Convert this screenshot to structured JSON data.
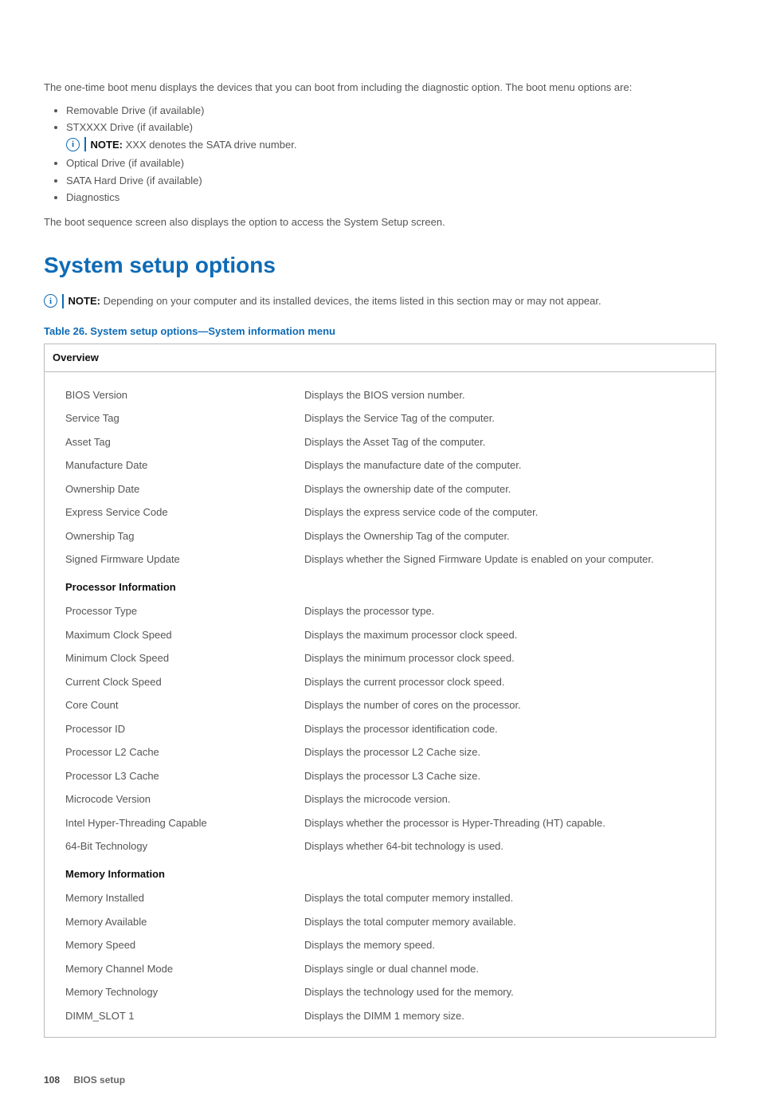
{
  "intro": "The one-time boot menu displays the devices that you can boot from including the diagnostic option. The boot menu options are:",
  "boot_list": {
    "item1": "Removable Drive (if available)",
    "item2": "STXXXX Drive (if available)",
    "item2_note_label": "NOTE:",
    "item2_note_text": " XXX denotes the SATA drive number.",
    "item3": "Optical Drive (if available)",
    "item4": "SATA Hard Drive (if available)",
    "item5": "Diagnostics"
  },
  "boot_seq": "The boot sequence screen also displays the option to access the System Setup screen.",
  "heading": "System setup options",
  "section_note_label": "NOTE:",
  "section_note_text": " Depending on your computer and its installed devices, the items listed in this section may or may not appear.",
  "table_caption": "Table 26. System setup options—System information menu",
  "table_header": "Overview",
  "rows": {
    "r0": {
      "l": "BIOS Version",
      "r": "Displays the BIOS version number."
    },
    "r1": {
      "l": "Service Tag",
      "r": "Displays the Service Tag of the computer."
    },
    "r2": {
      "l": "Asset Tag",
      "r": "Displays the Asset Tag of the computer."
    },
    "r3": {
      "l": "Manufacture Date",
      "r": "Displays the manufacture date of the computer."
    },
    "r4": {
      "l": "Ownership Date",
      "r": "Displays the ownership date of the computer."
    },
    "r5": {
      "l": "Express Service Code",
      "r": "Displays the express service code of the computer."
    },
    "r6": {
      "l": "Ownership Tag",
      "r": "Displays the Ownership Tag of the computer."
    },
    "r7": {
      "l": "Signed Firmware Update",
      "r": "Displays whether the Signed Firmware Update is enabled on your computer."
    },
    "sh1": "Processor Information",
    "r8": {
      "l": "Processor Type",
      "r": "Displays the processor type."
    },
    "r9": {
      "l": "Maximum Clock Speed",
      "r": "Displays the maximum processor clock speed."
    },
    "r10": {
      "l": "Minimum Clock Speed",
      "r": "Displays the minimum processor clock speed."
    },
    "r11": {
      "l": "Current Clock Speed",
      "r": "Displays the current processor clock speed."
    },
    "r12": {
      "l": "Core Count",
      "r": "Displays the number of cores on the processor."
    },
    "r13": {
      "l": "Processor ID",
      "r": "Displays the processor identification code."
    },
    "r14": {
      "l": "Processor L2 Cache",
      "r": "Displays the processor L2 Cache size."
    },
    "r15": {
      "l": "Processor L3 Cache",
      "r": "Displays the processor L3 Cache size."
    },
    "r16": {
      "l": "Microcode Version",
      "r": "Displays the microcode version."
    },
    "r17": {
      "l": "Intel Hyper-Threading Capable",
      "r": "Displays whether the processor is Hyper-Threading (HT) capable."
    },
    "r18": {
      "l": "64-Bit Technology",
      "r": "Displays whether 64-bit technology is used."
    },
    "sh2": "Memory Information",
    "r19": {
      "l": "Memory Installed",
      "r": "Displays the total computer memory installed."
    },
    "r20": {
      "l": "Memory Available",
      "r": "Displays the total computer memory available."
    },
    "r21": {
      "l": "Memory Speed",
      "r": "Displays the memory speed."
    },
    "r22": {
      "l": "Memory Channel Mode",
      "r": "Displays single or dual channel mode."
    },
    "r23": {
      "l": "Memory Technology",
      "r": "Displays the technology used for the memory."
    },
    "r24": {
      "l": "DIMM_SLOT 1",
      "r": "Displays the DIMM 1 memory size."
    }
  },
  "footer": {
    "page": "108",
    "chapter": "BIOS setup"
  },
  "info_glyph": "i"
}
